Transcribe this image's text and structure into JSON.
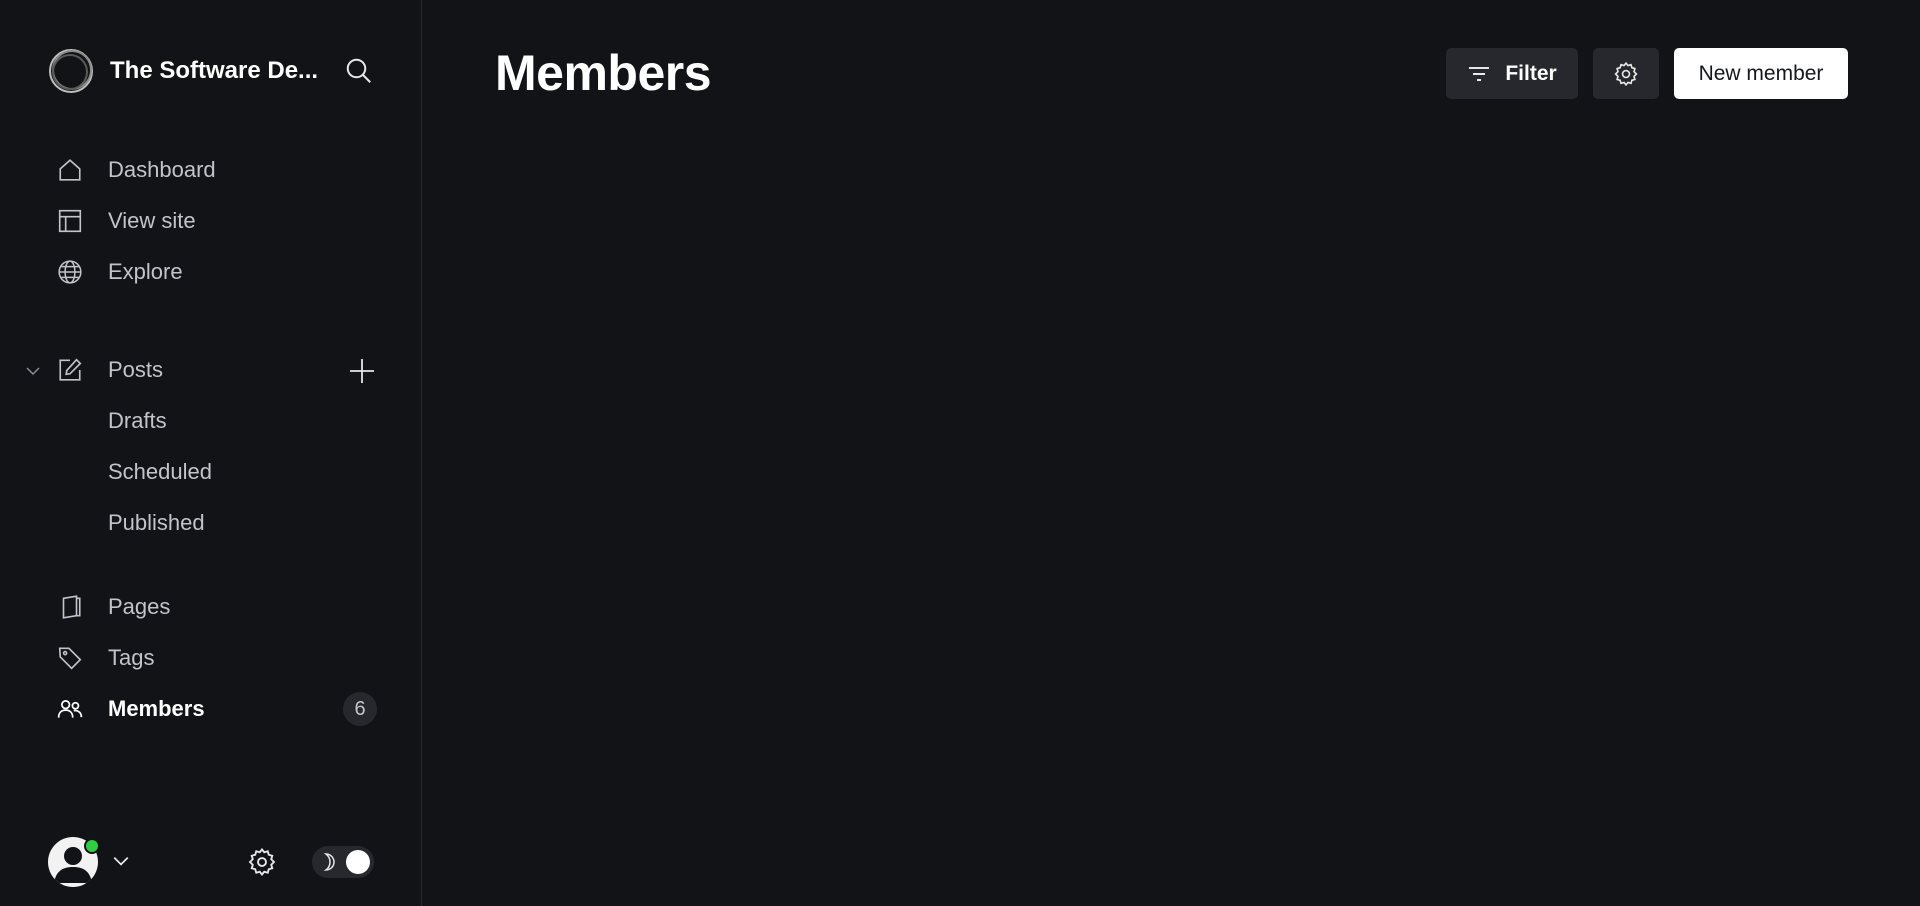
{
  "brand": {
    "title": "The Software De...",
    "logo_icon": "site-logo-icon"
  },
  "sidebar": {
    "search_icon": "search-icon",
    "primary_nav": [
      {
        "label": "Dashboard",
        "icon": "home-icon"
      },
      {
        "label": "View site",
        "icon": "layout-icon"
      },
      {
        "label": "Explore",
        "icon": "globe-icon"
      }
    ],
    "posts": {
      "label": "Posts",
      "icon": "edit-icon",
      "expanded": true,
      "sub_items": [
        "Drafts",
        "Scheduled",
        "Published"
      ]
    },
    "secondary_nav": [
      {
        "label": "Pages",
        "icon": "page-icon"
      },
      {
        "label": "Tags",
        "icon": "tag-icon"
      },
      {
        "label": "Members",
        "icon": "members-icon",
        "active": true,
        "count": "6"
      }
    ],
    "footer": {
      "user_status": "online",
      "theme": "dark"
    }
  },
  "main": {
    "title": "Members",
    "filter_label": "Filter",
    "new_member_label": "New member"
  },
  "colors": {
    "background": "#121317",
    "sidebar_border": "#26282d",
    "button_dark": "#26282d",
    "button_light": "#ffffff",
    "status_online": "#30cf43",
    "text_muted": "#c1c4c9",
    "text_strong": "#ffffff"
  }
}
